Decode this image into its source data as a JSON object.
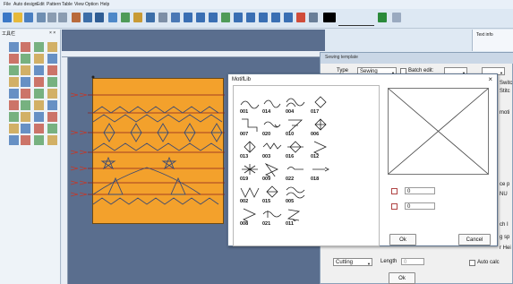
{
  "menu": [
    "File",
    "Auto design",
    "Edit",
    "Pattern",
    "Table",
    "View",
    "Option",
    "Help"
  ],
  "left_panel_title": "工具栏",
  "text_info_title": "Text info",
  "sewing_template": {
    "title": "Sewing template",
    "type_label": "Type",
    "type_value": "Sewing",
    "batch_edit_label": "Batch edit:",
    "side_texts": [
      "Switc",
      "Stitc",
      "moti",
      "ce p",
      "NU",
      "ch I",
      "g sp",
      "r Hei"
    ],
    "method_value": "Cutting",
    "length_label": "Length",
    "length_value": "0",
    "auto_cal_label": "Auto calc",
    "ok_label": "Ok"
  },
  "motif_dialog": {
    "title": "MotifLib",
    "close_glyph": "×",
    "cells": [
      "001",
      "007",
      "013",
      "019",
      "002",
      "008",
      "014",
      "020",
      "003",
      "009",
      "015",
      "021",
      "004",
      "010",
      "016",
      "022",
      "005",
      "011",
      "017",
      "006",
      "012",
      "018"
    ],
    "field1_value": "0",
    "field2_value": "0",
    "ok_label": "Ok",
    "cancel_label": "Cancel"
  },
  "colors": {
    "fabric": "#f3a12c",
    "canvas": "#5a6e8e",
    "stitch_line": "#c0392b",
    "panel": "#eef3f8"
  }
}
